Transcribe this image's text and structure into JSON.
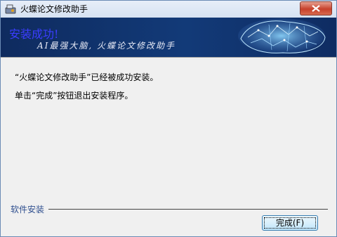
{
  "window": {
    "title": "火蝶论文修改助手"
  },
  "banner": {
    "heading": "安装成功!",
    "subtitle": "AI最强大脑, 火蝶论文修改助手"
  },
  "body": {
    "line1": "“火蝶论文修改助手”已经被成功安装。",
    "line2": "单击“完成”按钮退出安装程序。"
  },
  "footer": {
    "label": "软件安装",
    "finish_label": "完成(F)"
  },
  "colors": {
    "banner_bg": "#123a78",
    "heading": "#3b3dff",
    "close_button": "#c7412b"
  },
  "icons": [
    "installer-app-icon",
    "close-icon",
    "brain-graphic"
  ]
}
